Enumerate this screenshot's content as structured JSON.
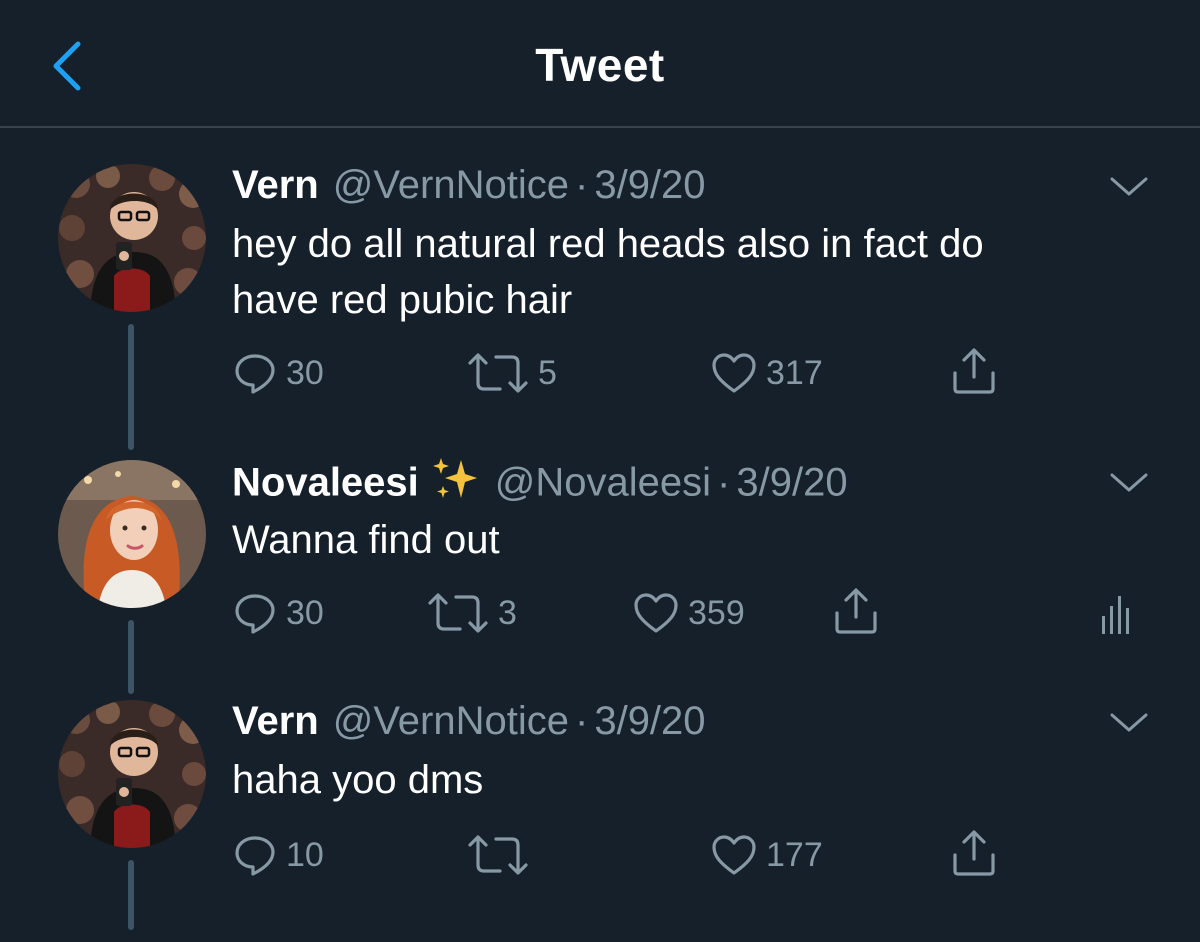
{
  "header": {
    "title": "Tweet",
    "back_icon": "chevron-left-icon",
    "accent": "#1da1f2"
  },
  "colors": {
    "background": "#15202b",
    "muted": "#8899a6",
    "divider": "#38444d",
    "thread_line": "#3d5466"
  },
  "tweets": [
    {
      "name": "Vern",
      "handle": "@VernNotice",
      "separator": "·",
      "date": "3/9/20",
      "text_lines": [
        "hey do all natural red heads also in fact do",
        "have red pubic hair"
      ],
      "replies": "30",
      "retweets": "5",
      "likes": "317"
    },
    {
      "name": "Novaleesi",
      "handle": "@Novaleesi",
      "separator": "·",
      "date": "3/9/20",
      "emoji": "sparkles-icon",
      "text_lines": [
        "Wanna find out"
      ],
      "replies": "30",
      "retweets": "3",
      "likes": "359",
      "analytics_icon": "analytics-icon"
    },
    {
      "name": "Vern",
      "handle": "@VernNotice",
      "separator": "·",
      "date": "3/9/20",
      "text_lines": [
        "haha yoo dms"
      ],
      "replies": "10",
      "retweets": "",
      "likes": "177"
    }
  ]
}
